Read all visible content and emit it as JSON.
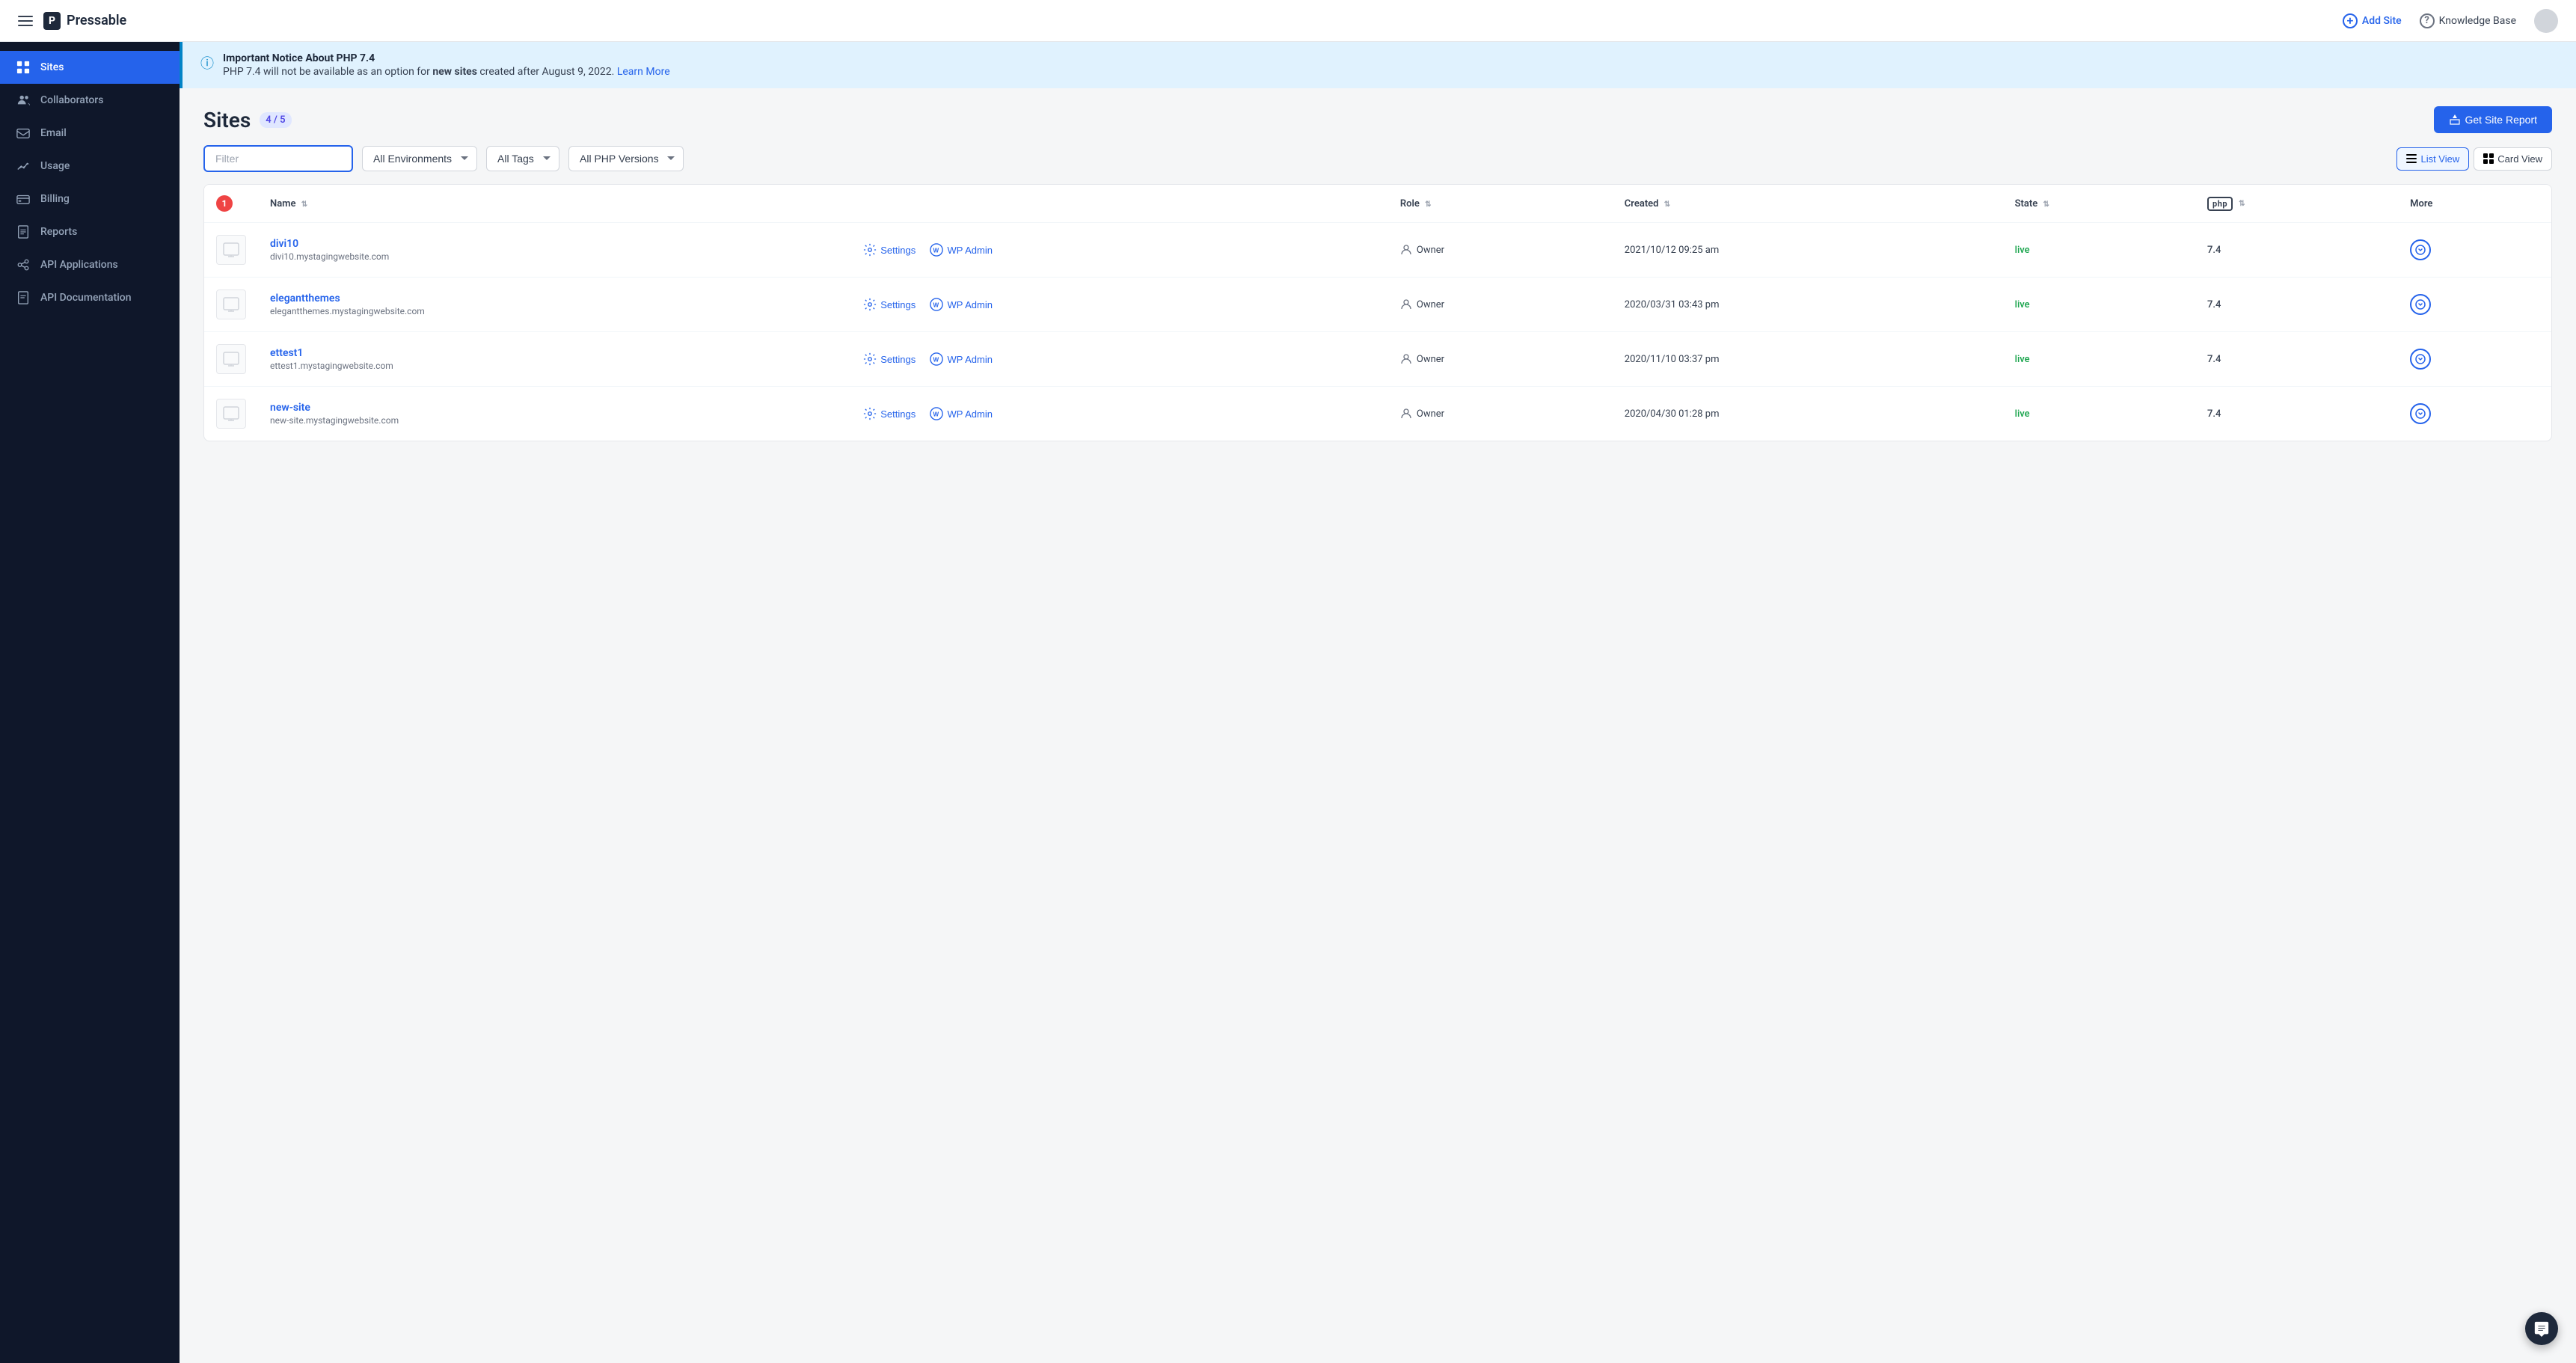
{
  "header": {
    "hamburger_label": "menu",
    "logo_abbr": "P",
    "logo_name": "Pressable",
    "add_site_label": "Add Site",
    "knowledge_base_label": "Knowledge Base",
    "knowledge_base_icon": "?"
  },
  "sidebar": {
    "items": [
      {
        "id": "sites",
        "label": "Sites",
        "active": true,
        "icon": "grid"
      },
      {
        "id": "collaborators",
        "label": "Collaborators",
        "active": false,
        "icon": "people"
      },
      {
        "id": "email",
        "label": "Email",
        "active": false,
        "icon": "email"
      },
      {
        "id": "usage",
        "label": "Usage",
        "active": false,
        "icon": "chart"
      },
      {
        "id": "billing",
        "label": "Billing",
        "active": false,
        "icon": "billing"
      },
      {
        "id": "reports",
        "label": "Reports",
        "active": false,
        "icon": "reports"
      },
      {
        "id": "api-applications",
        "label": "API Applications",
        "active": false,
        "icon": "api"
      },
      {
        "id": "api-documentation",
        "label": "API Documentation",
        "active": false,
        "icon": "doc"
      }
    ]
  },
  "notice": {
    "title": "Important Notice About PHP 7.4",
    "text_before": "PHP 7.4 will not be available as an option for ",
    "text_bold": "new sites",
    "text_after": " created after August 9, 2022.",
    "link_text": "Learn More",
    "link_url": "#"
  },
  "sites_page": {
    "title": "Sites",
    "count": "4 / 5",
    "get_report_label": "Get Site Report",
    "filter_placeholder": "Filter",
    "env_label": "All Environments",
    "tags_label": "All Tags",
    "php_label": "All PHP Versions",
    "list_view_label": "List View",
    "card_view_label": "Card View",
    "table": {
      "columns": {
        "name": "Name",
        "role": "Role",
        "created": "Created",
        "state": "State",
        "php": "PHP",
        "more": "More"
      },
      "badge_count": "1",
      "rows": [
        {
          "id": "divi10",
          "name": "divi10",
          "url": "divi10.mystagingwebsite.com",
          "settings_label": "Settings",
          "wp_admin_label": "WP Admin",
          "role": "Owner",
          "created": "2021/10/12 09:25 am",
          "state": "live",
          "php": "7.4"
        },
        {
          "id": "elegantthemes",
          "name": "elegantthemes",
          "url": "elegantthemes.mystagingwebsite.com",
          "settings_label": "Settings",
          "wp_admin_label": "WP Admin",
          "role": "Owner",
          "created": "2020/03/31 03:43 pm",
          "state": "live",
          "php": "7.4"
        },
        {
          "id": "ettest1",
          "name": "ettest1",
          "url": "ettest1.mystagingwebsite.com",
          "settings_label": "Settings",
          "wp_admin_label": "WP Admin",
          "role": "Owner",
          "created": "2020/11/10 03:37 pm",
          "state": "live",
          "php": "7.4"
        },
        {
          "id": "new-site",
          "name": "new-site",
          "url": "new-site.mystagingwebsite.com",
          "settings_label": "Settings",
          "wp_admin_label": "WP Admin",
          "role": "Owner",
          "created": "2020/04/30 01:28 pm",
          "state": "live",
          "php": "7.4"
        }
      ]
    }
  }
}
